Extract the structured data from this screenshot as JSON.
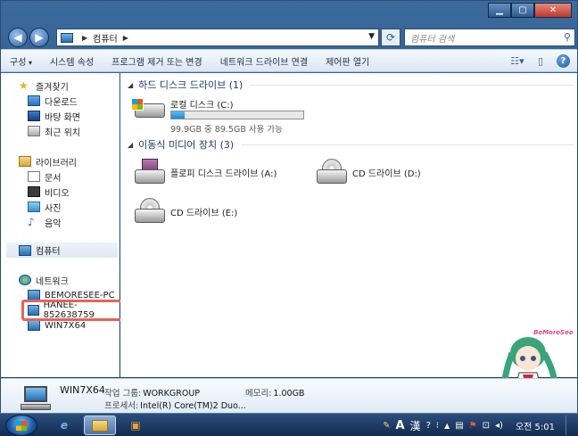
{
  "window": {
    "title": "",
    "minimize": "▁",
    "maximize": "▢",
    "close": "✕"
  },
  "address": {
    "path": "컴퓨터",
    "search_placeholder": "컴퓨터 검색"
  },
  "toolbar": {
    "items": [
      "구성",
      "시스템 속성",
      "프로그램 제거 또는 변경",
      "네트워크 드라이브 연결",
      "제어판 열기"
    ]
  },
  "sidebar": {
    "favorites": {
      "label": "즐겨찾기",
      "items": [
        "다운로드",
        "바탕 화면",
        "최근 위치"
      ]
    },
    "libraries": {
      "label": "라이브러리",
      "items": [
        "문서",
        "비디오",
        "사진",
        "음악"
      ]
    },
    "computer": {
      "label": "컴퓨터"
    },
    "network": {
      "label": "네트워크",
      "items": [
        "BEMORESEE-PC",
        "HANEE-852638759",
        "WIN7X64"
      ]
    }
  },
  "content": {
    "hdd_section": "하드 디스크 드라이브 (1)",
    "local_disk": {
      "label": "로컬 디스크 (C:)",
      "info": "99.9GB 중 89.5GB 사용 가능",
      "used_fraction": 0.104
    },
    "removable_section": "이동식 미디어 장치 (3)",
    "drives": [
      "플로피 디스크 드라이브 (A:)",
      "CD 드라이브 (D:)",
      "CD 드라이브 (E:)"
    ]
  },
  "mascot_tag": "BeMoreSee",
  "details": {
    "name": "WIN7X64",
    "workgroup_label": "작업 그룹:",
    "workgroup": "WORKGROUP",
    "memory_label": "메모리:",
    "memory": "1.00GB",
    "processor_label": "프로세서:",
    "processor": "Intel(R) Core(TM)2 Duo..."
  },
  "taskbar": {
    "tray_ime_a": "A",
    "tray_ime_han": "漢",
    "clock": "오전 5:01"
  }
}
